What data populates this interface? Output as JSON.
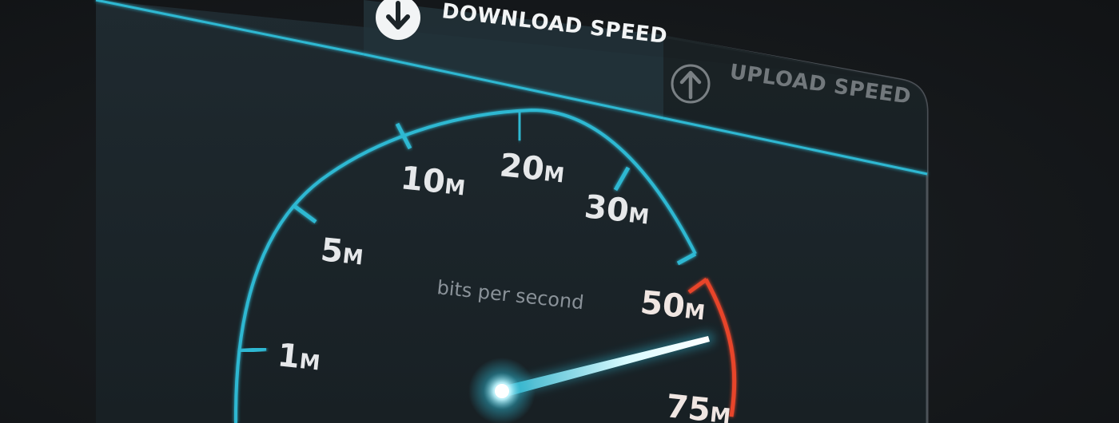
{
  "tabs": {
    "download": {
      "label": "DOWNLOAD SPEED",
      "icon": "arrow-down-icon",
      "active": true
    },
    "upload": {
      "label": "UPLOAD SPEED",
      "icon": "arrow-up-icon",
      "active": false
    }
  },
  "gauge": {
    "unit_label": "bits per second",
    "ticks": [
      {
        "label": "1",
        "suffix": "M"
      },
      {
        "label": "5",
        "suffix": "M"
      },
      {
        "label": "10",
        "suffix": "M"
      },
      {
        "label": "20",
        "suffix": "M"
      },
      {
        "label": "30",
        "suffix": "M"
      },
      {
        "label": "50",
        "suffix": "M"
      },
      {
        "label": "75",
        "suffix": "M"
      }
    ],
    "needle_reading_mbps": 50
  },
  "colors": {
    "accent": "#2fb8d2",
    "warning": "#e8452c",
    "text": "#e6e8ea",
    "muted": "#8a9299"
  }
}
